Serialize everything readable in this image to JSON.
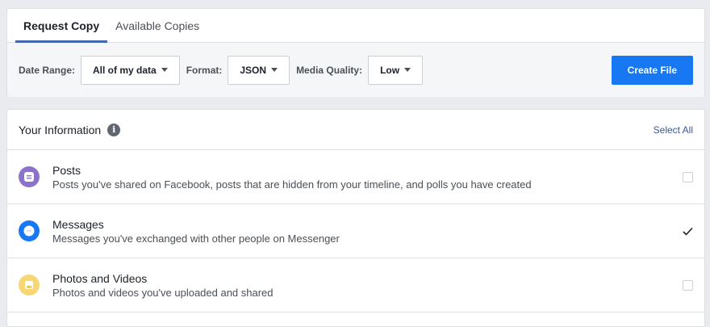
{
  "tabs": [
    {
      "label": "Request Copy",
      "active": true
    },
    {
      "label": "Available Copies",
      "active": false
    }
  ],
  "filters": {
    "date_range_label": "Date Range:",
    "date_range_value": "All of my data",
    "format_label": "Format:",
    "format_value": "JSON",
    "media_quality_label": "Media Quality:",
    "media_quality_value": "Low",
    "create_button": "Create File"
  },
  "info": {
    "title": "Your Information",
    "info_icon_glyph": "i",
    "select_all": "Select All",
    "items": [
      {
        "title": "Posts",
        "description": "Posts you've shared on Facebook, posts that are hidden from your timeline, and polls you have created",
        "checked": false,
        "icon": "posts-icon",
        "color": "#8c72cb"
      },
      {
        "title": "Messages",
        "description": "Messages you've exchanged with other people on Messenger",
        "checked": true,
        "icon": "messenger-icon",
        "color": "#1877f2"
      },
      {
        "title": "Photos and Videos",
        "description": "Photos and videos you've uploaded and shared",
        "checked": false,
        "icon": "photos-icon",
        "color": "#f7d774"
      }
    ]
  }
}
